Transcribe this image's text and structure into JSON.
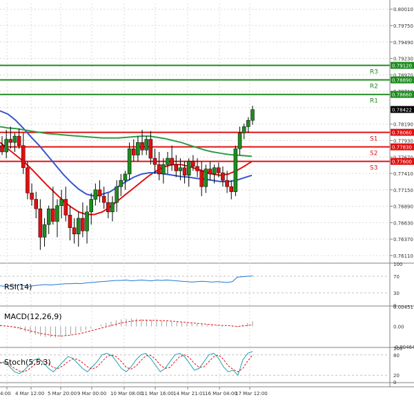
{
  "chart_data": {
    "type": "candlestick",
    "price_axis": {
      "ticks": [
        "0.80010",
        "0.79750",
        "0.79490",
        "0.79230",
        "0.78970",
        "0.78710",
        "0.78450",
        "0.78190",
        "0.77930",
        "0.77670",
        "0.77410",
        "0.77150",
        "0.76890",
        "0.76630",
        "0.76370",
        "0.76110"
      ],
      "min": 0.7611,
      "max": 0.8001
    },
    "time_axis": {
      "labels": [
        "4:00",
        "4 Mar 12:00",
        "5 Mar 20:00",
        "9 Mar 00:00",
        "10 Mar 08:00",
        "11 Mar 16:00",
        "14 Mar 21:01",
        "16 Mar 04:00",
        "17 Mar 12:00"
      ]
    },
    "levels": [
      {
        "name": "R3",
        "value": "0.79120",
        "price": 0.7912,
        "color": "#1e8c1e"
      },
      {
        "name": "R2",
        "value": "0.78890",
        "price": 0.7889,
        "color": "#1e8c1e"
      },
      {
        "name": "R1",
        "value": "0.78660",
        "price": 0.7866,
        "color": "#1e8c1e"
      },
      {
        "name": "S1",
        "value": "0.78060",
        "price": 0.7806,
        "color": "#e01010"
      },
      {
        "name": "S2",
        "value": "0.77830",
        "price": 0.7783,
        "color": "#e01010"
      },
      {
        "name": "S3",
        "value": "0.77600",
        "price": 0.776,
        "color": "#e01010"
      }
    ],
    "current_price": {
      "value": "0.78422",
      "price": 0.78422
    },
    "candles": [
      {
        "o": 0.7785,
        "h": 0.78,
        "l": 0.777,
        "c": 0.7775
      },
      {
        "o": 0.7775,
        "h": 0.781,
        "l": 0.7765,
        "c": 0.7795
      },
      {
        "o": 0.7795,
        "h": 0.7815,
        "l": 0.778,
        "c": 0.779
      },
      {
        "o": 0.779,
        "h": 0.7805,
        "l": 0.7775,
        "c": 0.78
      },
      {
        "o": 0.78,
        "h": 0.7812,
        "l": 0.778,
        "c": 0.7785
      },
      {
        "o": 0.7785,
        "h": 0.7805,
        "l": 0.774,
        "c": 0.775
      },
      {
        "o": 0.775,
        "h": 0.776,
        "l": 0.77,
        "c": 0.771
      },
      {
        "o": 0.771,
        "h": 0.7725,
        "l": 0.769,
        "c": 0.77
      },
      {
        "o": 0.77,
        "h": 0.7712,
        "l": 0.767,
        "c": 0.7685
      },
      {
        "o": 0.7685,
        "h": 0.77,
        "l": 0.762,
        "c": 0.764
      },
      {
        "o": 0.764,
        "h": 0.767,
        "l": 0.7625,
        "c": 0.766
      },
      {
        "o": 0.766,
        "h": 0.769,
        "l": 0.7645,
        "c": 0.7685
      },
      {
        "o": 0.7685,
        "h": 0.772,
        "l": 0.766,
        "c": 0.7665
      },
      {
        "o": 0.7665,
        "h": 0.77,
        "l": 0.764,
        "c": 0.769
      },
      {
        "o": 0.769,
        "h": 0.7715,
        "l": 0.767,
        "c": 0.77
      },
      {
        "o": 0.77,
        "h": 0.772,
        "l": 0.7665,
        "c": 0.7675
      },
      {
        "o": 0.7675,
        "h": 0.769,
        "l": 0.7635,
        "c": 0.7655
      },
      {
        "o": 0.7655,
        "h": 0.767,
        "l": 0.763,
        "c": 0.7645
      },
      {
        "o": 0.7645,
        "h": 0.768,
        "l": 0.7625,
        "c": 0.767
      },
      {
        "o": 0.767,
        "h": 0.7695,
        "l": 0.764,
        "c": 0.765
      },
      {
        "o": 0.765,
        "h": 0.769,
        "l": 0.763,
        "c": 0.768
      },
      {
        "o": 0.768,
        "h": 0.771,
        "l": 0.766,
        "c": 0.77
      },
      {
        "o": 0.77,
        "h": 0.7725,
        "l": 0.769,
        "c": 0.7715
      },
      {
        "o": 0.7715,
        "h": 0.773,
        "l": 0.7695,
        "c": 0.7705
      },
      {
        "o": 0.7705,
        "h": 0.772,
        "l": 0.7685,
        "c": 0.7695
      },
      {
        "o": 0.7695,
        "h": 0.771,
        "l": 0.767,
        "c": 0.768
      },
      {
        "o": 0.768,
        "h": 0.7705,
        "l": 0.7665,
        "c": 0.7695
      },
      {
        "o": 0.7695,
        "h": 0.773,
        "l": 0.768,
        "c": 0.772
      },
      {
        "o": 0.772,
        "h": 0.774,
        "l": 0.7705,
        "c": 0.773
      },
      {
        "o": 0.773,
        "h": 0.7745,
        "l": 0.7715,
        "c": 0.774
      },
      {
        "o": 0.774,
        "h": 0.779,
        "l": 0.773,
        "c": 0.778
      },
      {
        "o": 0.778,
        "h": 0.7795,
        "l": 0.776,
        "c": 0.777
      },
      {
        "o": 0.777,
        "h": 0.78,
        "l": 0.776,
        "c": 0.779
      },
      {
        "o": 0.779,
        "h": 0.781,
        "l": 0.777,
        "c": 0.7778
      },
      {
        "o": 0.7778,
        "h": 0.78,
        "l": 0.777,
        "c": 0.7795
      },
      {
        "o": 0.7795,
        "h": 0.7808,
        "l": 0.7755,
        "c": 0.7765
      },
      {
        "o": 0.7765,
        "h": 0.778,
        "l": 0.774,
        "c": 0.7755
      },
      {
        "o": 0.7755,
        "h": 0.7775,
        "l": 0.773,
        "c": 0.774
      },
      {
        "o": 0.774,
        "h": 0.7765,
        "l": 0.7725,
        "c": 0.7755
      },
      {
        "o": 0.7755,
        "h": 0.7775,
        "l": 0.774,
        "c": 0.7765
      },
      {
        "o": 0.7765,
        "h": 0.7785,
        "l": 0.7745,
        "c": 0.7755
      },
      {
        "o": 0.7755,
        "h": 0.777,
        "l": 0.7735,
        "c": 0.7745
      },
      {
        "o": 0.7745,
        "h": 0.7765,
        "l": 0.773,
        "c": 0.775
      },
      {
        "o": 0.775,
        "h": 0.776,
        "l": 0.7725,
        "c": 0.7738
      },
      {
        "o": 0.7738,
        "h": 0.7765,
        "l": 0.772,
        "c": 0.776
      },
      {
        "o": 0.776,
        "h": 0.777,
        "l": 0.7745,
        "c": 0.7752
      },
      {
        "o": 0.7752,
        "h": 0.7765,
        "l": 0.7735,
        "c": 0.7745
      },
      {
        "o": 0.7745,
        "h": 0.776,
        "l": 0.7705,
        "c": 0.772
      },
      {
        "o": 0.772,
        "h": 0.7755,
        "l": 0.771,
        "c": 0.7748
      },
      {
        "o": 0.7748,
        "h": 0.776,
        "l": 0.773,
        "c": 0.774
      },
      {
        "o": 0.774,
        "h": 0.7755,
        "l": 0.7725,
        "c": 0.775
      },
      {
        "o": 0.775,
        "h": 0.7758,
        "l": 0.7735,
        "c": 0.7742
      },
      {
        "o": 0.7742,
        "h": 0.7752,
        "l": 0.772,
        "c": 0.773
      },
      {
        "o": 0.773,
        "h": 0.7745,
        "l": 0.771,
        "c": 0.772
      },
      {
        "o": 0.772,
        "h": 0.773,
        "l": 0.77,
        "c": 0.7712
      },
      {
        "o": 0.7712,
        "h": 0.7785,
        "l": 0.7705,
        "c": 0.778
      },
      {
        "o": 0.778,
        "h": 0.7815,
        "l": 0.777,
        "c": 0.7805
      },
      {
        "o": 0.7805,
        "h": 0.782,
        "l": 0.7795,
        "c": 0.7815
      },
      {
        "o": 0.7815,
        "h": 0.783,
        "l": 0.7805,
        "c": 0.7825
      },
      {
        "o": 0.7825,
        "h": 0.7848,
        "l": 0.7818,
        "c": 0.7842
      }
    ],
    "ma_series": [
      {
        "color": "#e01010",
        "values": [
          0.779,
          0.778,
          0.777,
          0.776,
          0.7748,
          0.7735,
          0.7722,
          0.771,
          0.7698,
          0.7688,
          0.768,
          0.7676,
          0.7676,
          0.768,
          0.7688,
          0.7698,
          0.7708,
          0.7718,
          0.7728,
          0.7738,
          0.7746,
          0.7752,
          0.7755,
          0.7755,
          0.7752,
          0.7748,
          0.7744,
          0.774,
          0.7738,
          0.774,
          0.7745,
          0.7752,
          0.776
        ]
      },
      {
        "color": "#3355cc",
        "values": [
          0.784,
          0.7835,
          0.7825,
          0.7812,
          0.7798,
          0.7785,
          0.777,
          0.7755,
          0.774,
          0.7727,
          0.7716,
          0.7708,
          0.7705,
          0.7708,
          0.7712,
          0.772,
          0.7728,
          0.7735,
          0.774,
          0.7742,
          0.7742,
          0.774,
          0.7738,
          0.7736,
          0.7735,
          0.7733,
          0.7732,
          0.773,
          0.7728,
          0.7728,
          0.773,
          0.7734,
          0.7738
        ]
      },
      {
        "color": "#2e9b47",
        "values": [
          0.7815,
          0.7813,
          0.7812,
          0.781,
          0.7808,
          0.7806,
          0.7804,
          0.7803,
          0.7802,
          0.7801,
          0.78,
          0.7799,
          0.7798,
          0.7797,
          0.7797,
          0.7797,
          0.7798,
          0.7799,
          0.78,
          0.78,
          0.7798,
          0.7796,
          0.7793,
          0.779,
          0.7786,
          0.7782,
          0.7778,
          0.7775,
          0.7773,
          0.7771,
          0.777,
          0.7769,
          0.7768
        ]
      }
    ],
    "rsi": {
      "label": "RSI(14)",
      "ticks": [
        "100",
        "70",
        "30",
        "0"
      ],
      "values": [
        47,
        46,
        47,
        48,
        49,
        47,
        46,
        48,
        49,
        50,
        49,
        50,
        51,
        52,
        52,
        53,
        52,
        54,
        55,
        56,
        57,
        58,
        59,
        60,
        60,
        61,
        59,
        60,
        61,
        60,
        59,
        61,
        60,
        61,
        60,
        59,
        58,
        57,
        56,
        57,
        58,
        57,
        56,
        57,
        56,
        55,
        57,
        68,
        69,
        70,
        71
      ]
    },
    "macd": {
      "label": "MACD(12,26,9)",
      "ticks": [
        "0.00451",
        "0.00",
        "-0.004646"
      ],
      "values": [
        0.0004,
        0.0002,
        -0.0001,
        -0.0004,
        -0.0008,
        -0.0012,
        -0.0016,
        -0.0019,
        -0.0022,
        -0.0024,
        -0.0025,
        -0.0025,
        -0.0024,
        -0.0022,
        -0.0019,
        -0.0016,
        -0.0012,
        -0.0008,
        -0.0004,
        0.0,
        0.0004,
        0.0008,
        0.0011,
        0.0014,
        0.0016,
        0.0017,
        0.0018,
        0.0018,
        0.0017,
        0.0016,
        0.0015,
        0.0014,
        0.0013,
        0.0012,
        0.0011,
        0.001,
        0.0009,
        0.0008,
        0.0007,
        0.0006,
        0.0005,
        0.0004,
        0.0003,
        0.0002,
        0.0001,
        0.0,
        -0.0001,
        -0.0002,
        0.0004,
        0.0008,
        0.0012
      ],
      "signal": [
        0.0002,
        0.0001,
        0.0,
        -0.0002,
        -0.0004,
        -0.0007,
        -0.001,
        -0.0013,
        -0.0016,
        -0.0018,
        -0.002,
        -0.0021,
        -0.0022,
        -0.0021,
        -0.002,
        -0.0018,
        -0.0016,
        -0.0013,
        -0.001,
        -0.0007,
        -0.0004,
        -0.0001,
        0.0002,
        0.0005,
        0.0008,
        0.001,
        0.0012,
        0.0013,
        0.0014,
        0.0014,
        0.0014,
        0.0014,
        0.0013,
        0.0013,
        0.0012,
        0.0011,
        0.001,
        0.0009,
        0.0008,
        0.0007,
        0.0006,
        0.0005,
        0.0004,
        0.0003,
        0.0002,
        0.0002,
        0.0001,
        0.0,
        0.0001,
        0.0002,
        0.0004
      ]
    },
    "stoch": {
      "label": "Stoch(5,5,3)",
      "ticks": [
        "100",
        "80",
        "20",
        "0"
      ],
      "k": [
        55,
        60,
        45,
        30,
        25,
        35,
        50,
        65,
        70,
        55,
        40,
        30,
        45,
        60,
        75,
        70,
        55,
        40,
        30,
        45,
        60,
        80,
        85,
        78,
        60,
        40,
        30,
        45,
        65,
        80,
        85,
        70,
        50,
        30,
        40,
        60,
        80,
        85,
        75,
        55,
        35,
        40,
        60,
        80,
        85,
        70,
        45,
        30,
        35,
        20,
        65,
        85,
        90
      ],
      "d": [
        58,
        55,
        50,
        40,
        32,
        30,
        38,
        50,
        62,
        62,
        55,
        42,
        40,
        48,
        60,
        68,
        67,
        57,
        45,
        38,
        45,
        60,
        75,
        80,
        74,
        60,
        43,
        38,
        47,
        63,
        77,
        79,
        68,
        50,
        40,
        43,
        60,
        75,
        80,
        72,
        55,
        43,
        45,
        60,
        75,
        80,
        67,
        48,
        37,
        30,
        40,
        62,
        80
      ]
    },
    "colors": {
      "bull": "#1e8c1e",
      "bear": "#e01010",
      "ma_red": "#e01010",
      "ma_blue": "#3355cc",
      "ma_green": "#2e9b47",
      "rsi": "#1e78d2",
      "stoch_k": "#20a0b0",
      "stoch_d": "#e01010"
    }
  }
}
